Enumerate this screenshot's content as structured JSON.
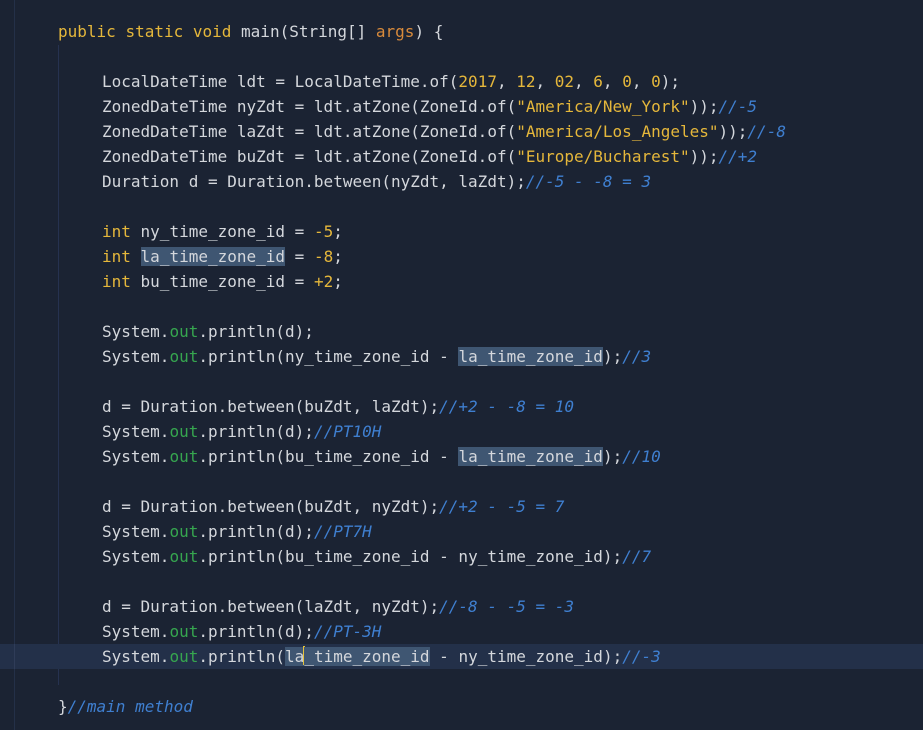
{
  "editor": {
    "lines": [
      {
        "t": [
          [
            "kw",
            "public"
          ],
          [
            "",
            "&nbsp;"
          ],
          [
            "kw",
            "static"
          ],
          [
            "",
            "&nbsp;"
          ],
          [
            "kw",
            "void"
          ],
          [
            "",
            "&nbsp;main(String[]&nbsp;"
          ],
          [
            "param",
            "args"
          ],
          [
            "",
            ")&nbsp;{"
          ]
        ]
      },
      {
        "t": []
      },
      {
        "t": [
          [
            "",
            "LocalDateTime&nbsp;ldt&nbsp;=&nbsp;LocalDateTime.of("
          ],
          [
            "num",
            "2017"
          ],
          [
            "",
            ",&nbsp;"
          ],
          [
            "num",
            "12"
          ],
          [
            "",
            ",&nbsp;"
          ],
          [
            "num",
            "02"
          ],
          [
            "",
            ",&nbsp;"
          ],
          [
            "num",
            "6"
          ],
          [
            "",
            ",&nbsp;"
          ],
          [
            "num",
            "0"
          ],
          [
            "",
            ",&nbsp;"
          ],
          [
            "num",
            "0"
          ],
          [
            "",
            ");"
          ]
        ]
      },
      {
        "t": [
          [
            "",
            "ZonedDateTime&nbsp;nyZdt&nbsp;=&nbsp;ldt.atZone(ZoneId.of("
          ],
          [
            "str",
            "\"America/New_York\""
          ],
          [
            "",
            "));"
          ],
          [
            "cmt",
            "//-5"
          ]
        ]
      },
      {
        "t": [
          [
            "",
            "ZonedDateTime&nbsp;laZdt&nbsp;=&nbsp;ldt.atZone(ZoneId.of("
          ],
          [
            "str",
            "\"America/Los_Angeles\""
          ],
          [
            "",
            "));"
          ],
          [
            "cmt",
            "//-8"
          ]
        ]
      },
      {
        "t": [
          [
            "",
            "ZonedDateTime&nbsp;buZdt&nbsp;=&nbsp;ldt.atZone(ZoneId.of("
          ],
          [
            "str",
            "\"Europe/Bucharest\""
          ],
          [
            "",
            "));"
          ],
          [
            "cmt",
            "//+2"
          ]
        ]
      },
      {
        "t": [
          [
            "",
            "Duration&nbsp;d&nbsp;=&nbsp;Duration.between(nyZdt,&nbsp;laZdt);"
          ],
          [
            "cmt",
            "//-5&nbsp;-&nbsp;-8&nbsp;=&nbsp;3"
          ]
        ]
      },
      {
        "t": []
      },
      {
        "t": [
          [
            "kw",
            "int"
          ],
          [
            "",
            "&nbsp;ny_time_zone_id&nbsp;=&nbsp;"
          ],
          [
            "num",
            "-5"
          ],
          [
            "",
            ";"
          ]
        ]
      },
      {
        "t": [
          [
            "kw",
            "int"
          ],
          [
            "",
            "&nbsp;"
          ],
          [
            "hl",
            "la_time_zone_id"
          ],
          [
            "",
            "&nbsp;=&nbsp;"
          ],
          [
            "num",
            "-8"
          ],
          [
            "",
            ";"
          ]
        ]
      },
      {
        "t": [
          [
            "kw",
            "int"
          ],
          [
            "",
            "&nbsp;bu_time_zone_id&nbsp;=&nbsp;"
          ],
          [
            "num",
            "+2"
          ],
          [
            "",
            ";"
          ]
        ]
      },
      {
        "t": []
      },
      {
        "t": [
          [
            "",
            "System."
          ],
          [
            "fld",
            "out"
          ],
          [
            "",
            ".println(d);"
          ]
        ]
      },
      {
        "t": [
          [
            "",
            "System."
          ],
          [
            "fld",
            "out"
          ],
          [
            "",
            ".println(ny_time_zone_id&nbsp;-&nbsp;"
          ],
          [
            "hl",
            "la_time_zone_id"
          ],
          [
            "",
            ");"
          ],
          [
            "cmt",
            "//3"
          ]
        ]
      },
      {
        "t": []
      },
      {
        "t": [
          [
            "",
            "d&nbsp;=&nbsp;Duration.between(buZdt,&nbsp;laZdt);"
          ],
          [
            "cmt",
            "//+2&nbsp;-&nbsp;-8&nbsp;=&nbsp;10"
          ]
        ]
      },
      {
        "t": [
          [
            "",
            "System."
          ],
          [
            "fld",
            "out"
          ],
          [
            "",
            ".println(d);"
          ],
          [
            "cmt",
            "//PT10H"
          ]
        ]
      },
      {
        "t": [
          [
            "",
            "System."
          ],
          [
            "fld",
            "out"
          ],
          [
            "",
            ".println(bu_time_zone_id&nbsp;-&nbsp;"
          ],
          [
            "hl",
            "la_time_zone_id"
          ],
          [
            "",
            ");"
          ],
          [
            "cmt",
            "//10"
          ]
        ]
      },
      {
        "t": []
      },
      {
        "t": [
          [
            "",
            "d&nbsp;=&nbsp;Duration.between(buZdt,&nbsp;nyZdt);"
          ],
          [
            "cmt",
            "//+2&nbsp;-&nbsp;-5&nbsp;=&nbsp;7"
          ]
        ]
      },
      {
        "t": [
          [
            "",
            "System."
          ],
          [
            "fld",
            "out"
          ],
          [
            "",
            ".println(d);"
          ],
          [
            "cmt",
            "//PT7H"
          ]
        ]
      },
      {
        "t": [
          [
            "",
            "System."
          ],
          [
            "fld",
            "out"
          ],
          [
            "",
            ".println(bu_time_zone_id&nbsp;-&nbsp;ny_time_zone_id);"
          ],
          [
            "cmt",
            "//7"
          ]
        ]
      },
      {
        "t": []
      },
      {
        "t": [
          [
            "",
            "d&nbsp;=&nbsp;Duration.between(laZdt,&nbsp;nyZdt);"
          ],
          [
            "cmt",
            "//-8&nbsp;-&nbsp;-5&nbsp;=&nbsp;-3"
          ]
        ]
      },
      {
        "t": [
          [
            "",
            "System."
          ],
          [
            "fld",
            "out"
          ],
          [
            "",
            ".println(d);"
          ],
          [
            "cmt",
            "//PT-3H"
          ]
        ]
      },
      {
        "t": [
          [
            "",
            "System."
          ],
          [
            "fld",
            "out"
          ],
          [
            "",
            ".println("
          ],
          [
            "hl",
            "la"
          ],
          [
            "caret",
            ""
          ],
          [
            "hl",
            "_time_zone_id"
          ],
          [
            "",
            "&nbsp;-&nbsp;ny_time_zone_id);"
          ],
          [
            "cmt",
            "//-3"
          ]
        ],
        "current": true
      },
      {
        "t": []
      },
      {
        "t": [
          [
            "",
            "}"
          ],
          [
            "cmt",
            "//main&nbsp;method"
          ]
        ]
      }
    ]
  },
  "colors": {
    "background": "#1b2333",
    "keyword": "#e5b73b",
    "comment": "#3f7fd0",
    "field": "#36a64f",
    "highlight": "#3f5672"
  }
}
